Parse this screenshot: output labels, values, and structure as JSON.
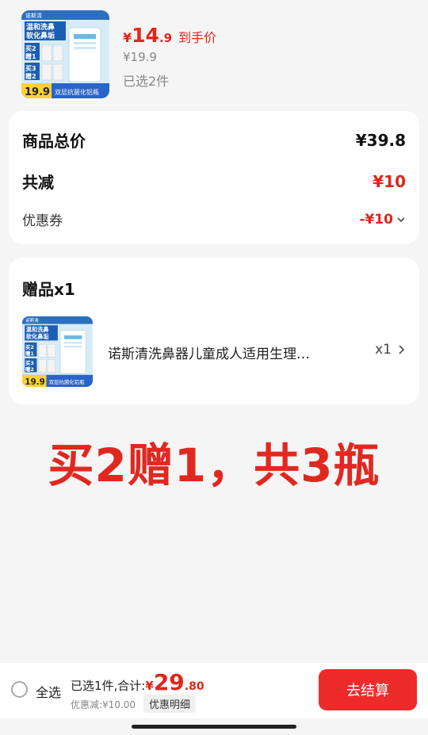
{
  "top_product": {
    "price_yen": "¥",
    "price_int": "14",
    "price_dec": ".9",
    "price_tag": "到手价",
    "original_price": "¥19.9",
    "selected_count": "已选2件",
    "thumb": {
      "brand_text": "诺斯清",
      "headline_1": "温和洗鼻",
      "headline_2": "软化鼻垢",
      "offer_1_top": "买2",
      "offer_1_bottom": "赠1",
      "offer_2_top": "买3",
      "offer_2_bottom": "赠2",
      "price_badge": "19.9",
      "footer_text": "双层抗菌化铝瓶"
    }
  },
  "summary": {
    "goods_total_label": "商品总价",
    "goods_total_value": "¥39.8",
    "reduction_label": "共减",
    "reduction_value": "¥10",
    "coupon_label": "优惠券",
    "coupon_value": "-¥10"
  },
  "gift": {
    "title": "赠品x1",
    "name": "诺斯清洗鼻器儿童成人适用生理…",
    "qty": "x1",
    "thumb": {
      "brand_text": "诺斯清",
      "headline_1": "温和洗鼻",
      "headline_2": "软化鼻垢",
      "offer_1_top": "买2",
      "offer_1_bottom": "赠1",
      "offer_2_top": "买3",
      "offer_2_bottom": "赠2",
      "price_badge": "19.9",
      "footer_text": "双层抗菌化铝瓶"
    }
  },
  "promo_text": "买2赠1，共3瓶",
  "bottom_bar": {
    "select_all_label": "全选",
    "total_prefix": "已选1件,合计:",
    "total_yen": "¥",
    "total_int": "29",
    "total_dec": ".80",
    "discount_text": "优惠减:¥10.00",
    "detail_button": "优惠明细",
    "checkout_button": "去结算"
  },
  "colors": {
    "accent_red": "#e1251b",
    "checkout_red": "#ee2b2b",
    "background": "#f5f5f5"
  }
}
